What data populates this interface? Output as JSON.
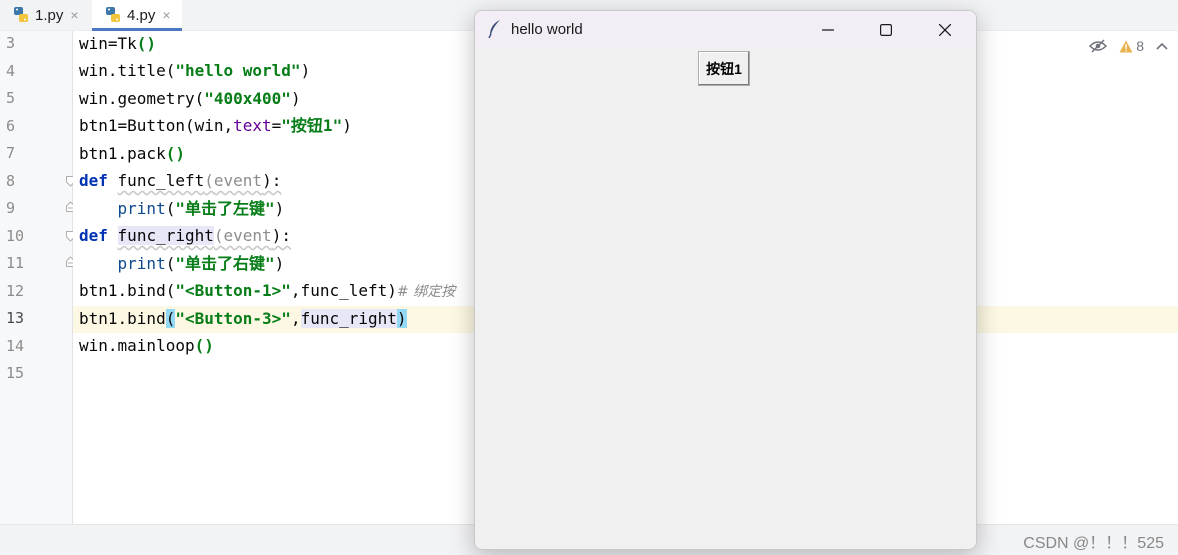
{
  "editor_tabs": [
    {
      "label": "1.py",
      "close": "×"
    },
    {
      "label": "4.py",
      "close": "×"
    }
  ],
  "line_numbers": [
    "3",
    "4",
    "5",
    "6",
    "7",
    "8",
    "9",
    "10",
    "11",
    "12",
    "13",
    "14",
    "15"
  ],
  "code": {
    "l3": {
      "a": "win=Tk",
      "b": "()"
    },
    "l4": {
      "a": "win.title(",
      "s": "\"hello world\"",
      "b": ")"
    },
    "l5": {
      "a": "win.geometry(",
      "s": "\"400x400\"",
      "b": ")"
    },
    "l6": {
      "a": "btn1=Button(win,",
      "k": "text",
      "eq": "=",
      "s": "\"按钮1\"",
      "b": ")"
    },
    "l7": {
      "a": "btn1.pack",
      "b": "()"
    },
    "l8": {
      "kw": "def",
      "fn": "func_left",
      "p1": "(",
      "param": "event",
      "p2": "):"
    },
    "l9": {
      "fn": "print",
      "p1": "(",
      "s": "\"单击了左键\"",
      "p2": ")"
    },
    "l10": {
      "kw": "def",
      "fn": "func_right",
      "p1": "(",
      "param": "event",
      "p2": "):"
    },
    "l11": {
      "fn": "print",
      "p1": "(",
      "s": "\"单击了右键\"",
      "p2": ")"
    },
    "l12": {
      "a": "btn1.bind(",
      "s": "\"<Button-1>\"",
      "b": ",func_left)",
      "c": "# 绑定按"
    },
    "l13": {
      "a": "btn1.bind",
      "p1": "(",
      "s": "\"<Button-3>\"",
      "comma": ",",
      "hl": "func_right",
      "p2": ")"
    },
    "l14": {
      "a": "win.mainloop",
      "b": "()"
    }
  },
  "inspection": {
    "warnings_count": "8"
  },
  "tk_window": {
    "title": "hello world",
    "button_label": "按钮1"
  },
  "status": {
    "credit": "CSDN @！！！525"
  },
  "colors": {
    "keyword": "#0033b3",
    "string": "#067d17",
    "accent_tab": "#4a78c2",
    "current_line": "#fdf8e3"
  }
}
